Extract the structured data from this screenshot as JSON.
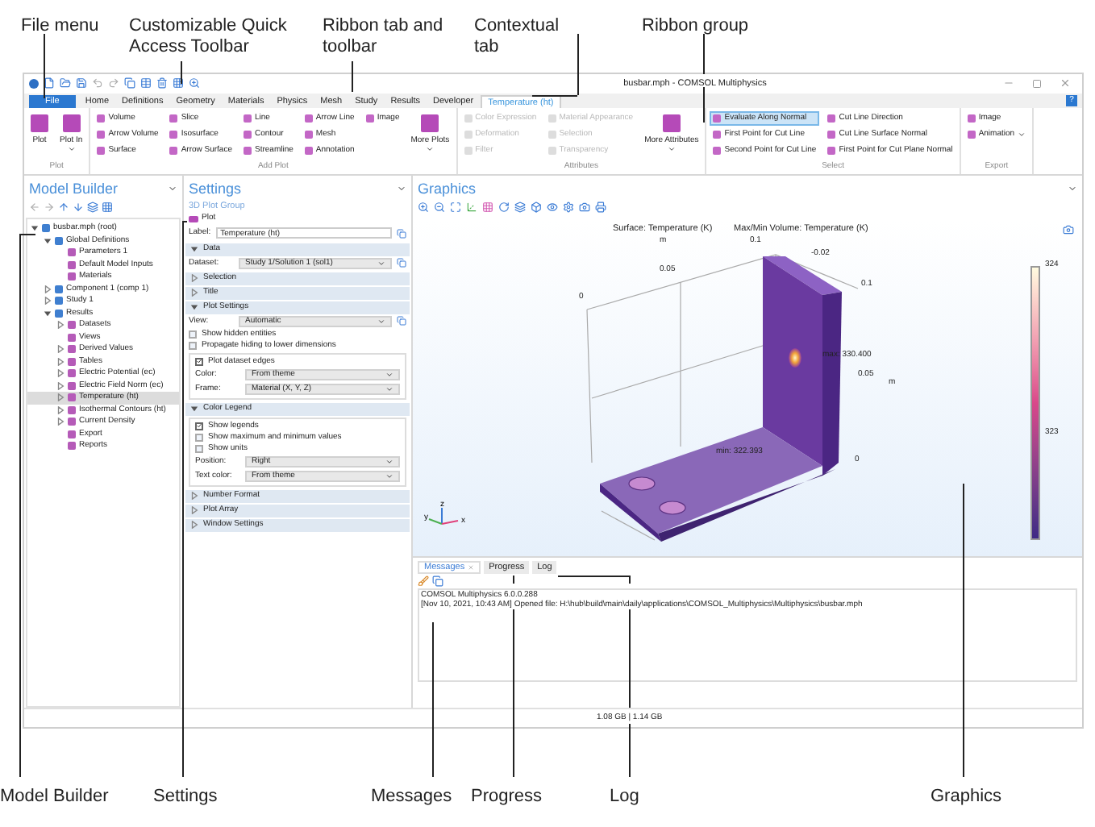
{
  "callouts_top": [
    {
      "label": "File menu"
    },
    {
      "label": "Customizable Quick Access Toolbar"
    },
    {
      "label": "Ribbon tab and toolbar"
    },
    {
      "label": "Contextual tab"
    },
    {
      "label": "Ribbon group"
    }
  ],
  "window": {
    "title": "busbar.mph - COMSOL Multiphysics"
  },
  "help_button": "?",
  "ribbon_tabs": [
    {
      "label": "File",
      "kind": "file",
      "selected": false
    },
    {
      "label": "Home",
      "kind": "standard",
      "selected": false
    },
    {
      "label": "Definitions",
      "kind": "standard",
      "selected": false
    },
    {
      "label": "Geometry",
      "kind": "standard",
      "selected": false
    },
    {
      "label": "Materials",
      "kind": "standard",
      "selected": false
    },
    {
      "label": "Physics",
      "kind": "standard",
      "selected": false
    },
    {
      "label": "Mesh",
      "kind": "standard",
      "selected": false
    },
    {
      "label": "Study",
      "kind": "standard",
      "selected": false
    },
    {
      "label": "Results",
      "kind": "standard",
      "selected": false
    },
    {
      "label": "Developer",
      "kind": "standard",
      "selected": false
    },
    {
      "label": "Temperature (ht)",
      "kind": "contextual",
      "selected": true
    }
  ],
  "ribbon_groups": [
    {
      "label": "Plot",
      "items": [
        {
          "kind": "big",
          "label": "Plot",
          "dropdown": false
        },
        {
          "kind": "big",
          "label": "Plot In",
          "dropdown": true
        }
      ]
    },
    {
      "label": "Add Plot",
      "items": [
        {
          "kind": "column",
          "entries": [
            {
              "label": "Volume"
            },
            {
              "label": "Arrow Volume"
            },
            {
              "label": "Surface"
            }
          ]
        },
        {
          "kind": "column",
          "entries": [
            {
              "label": "Slice"
            },
            {
              "label": "Isosurface"
            },
            {
              "label": "Arrow Surface"
            }
          ]
        },
        {
          "kind": "column",
          "entries": [
            {
              "label": "Line"
            },
            {
              "label": "Contour"
            },
            {
              "label": "Streamline"
            }
          ]
        },
        {
          "kind": "column",
          "entries": [
            {
              "label": "Arrow Line"
            },
            {
              "label": "Mesh"
            },
            {
              "label": "Annotation"
            }
          ]
        },
        {
          "kind": "column",
          "entries": [
            {
              "label": "Image"
            }
          ]
        },
        {
          "kind": "big",
          "label": "More Plots",
          "dropdown": true
        }
      ]
    },
    {
      "label": "Attributes",
      "items": [
        {
          "kind": "column",
          "entries": [
            {
              "label": "Color Expression",
              "disabled": true
            },
            {
              "label": "Deformation",
              "disabled": true
            },
            {
              "label": "Filter",
              "disabled": true
            }
          ]
        },
        {
          "kind": "column",
          "entries": [
            {
              "label": "Material Appearance",
              "disabled": true
            },
            {
              "label": "Selection",
              "disabled": true
            },
            {
              "label": "Transparency",
              "disabled": true
            }
          ]
        },
        {
          "kind": "big",
          "label": "More Attributes",
          "dropdown": true
        }
      ]
    },
    {
      "label": "Select",
      "items": [
        {
          "kind": "column",
          "entries": [
            {
              "label": "Evaluate Along Normal",
              "selected": true
            },
            {
              "label": "First Point for Cut Line",
              "selected": false
            },
            {
              "label": "Second Point for Cut Line",
              "selected": false
            }
          ]
        },
        {
          "kind": "column",
          "entries": [
            {
              "label": "Cut Line Direction",
              "selected": false
            },
            {
              "label": "Cut Line Surface Normal",
              "selected": false
            },
            {
              "label": "First Point for Cut Plane Normal",
              "selected": false
            }
          ]
        }
      ]
    },
    {
      "label": "Export",
      "items": [
        {
          "kind": "column",
          "entries": [
            {
              "label": "Image"
            },
            {
              "label": "Animation",
              "dropdown": true
            }
          ]
        }
      ]
    }
  ],
  "model_builder": {
    "title": "Model Builder",
    "tree": [
      {
        "label": "busbar.mph (root)",
        "expanded": true,
        "selected": false,
        "children": [
          {
            "label": "Global Definitions",
            "expanded": true,
            "selected": false,
            "children": [
              {
                "label": "Parameters 1",
                "selected": false
              },
              {
                "label": "Default Model Inputs",
                "selected": false
              },
              {
                "label": "Materials",
                "selected": false
              }
            ]
          },
          {
            "label": "Component 1 (comp 1)",
            "expanded": false,
            "selected": false
          },
          {
            "label": "Study 1",
            "expanded": false,
            "selected": false
          },
          {
            "label": "Results",
            "expanded": true,
            "selected": false,
            "children": [
              {
                "label": "Datasets",
                "expanded": false,
                "selected": false
              },
              {
                "label": "Views",
                "selected": false
              },
              {
                "label": "Derived Values",
                "expanded": false,
                "selected": false
              },
              {
                "label": "Tables",
                "expanded": false,
                "selected": false
              },
              {
                "label": "Electric Potential (ec)",
                "expanded": false,
                "selected": false
              },
              {
                "label": "Electric Field Norm (ec)",
                "expanded": false,
                "selected": false
              },
              {
                "label": "Temperature (ht)",
                "expanded": false,
                "selected": true
              },
              {
                "label": "Isothermal Contours (ht)",
                "expanded": false,
                "selected": false
              },
              {
                "label": "Current Density",
                "expanded": false,
                "selected": false
              },
              {
                "label": "Export",
                "selected": false
              },
              {
                "label": "Reports",
                "selected": false
              }
            ]
          }
        ]
      }
    ]
  },
  "settings": {
    "title": "Settings",
    "subtitle": "3D Plot Group",
    "plot_button": "Plot",
    "label_field": {
      "label": "Label:",
      "value": "Temperature (ht)"
    },
    "sections": [
      {
        "title": "Data",
        "expanded": true,
        "rows": [
          {
            "kind": "select",
            "label": "Dataset:",
            "value": "Study 1/Solution 1 (sol1)",
            "side_button": true
          }
        ]
      },
      {
        "title": "Selection",
        "expanded": false
      },
      {
        "title": "Title",
        "expanded": false
      },
      {
        "title": "Plot Settings",
        "expanded": true,
        "rows": [
          {
            "kind": "select",
            "label": "View:",
            "value": "Automatic",
            "side_button": true
          },
          {
            "kind": "checkbox",
            "label": "Show hidden entities",
            "checked": false
          },
          {
            "kind": "checkbox",
            "label": "Propagate hiding to lower dimensions",
            "checked": false
          },
          {
            "kind": "group",
            "rows": [
              {
                "kind": "checkbox",
                "label": "Plot dataset edges",
                "checked": true
              },
              {
                "kind": "select",
                "label": "Color:",
                "value": "From theme"
              },
              {
                "kind": "select",
                "label": "Frame:",
                "value": "Material  (X, Y, Z)"
              }
            ]
          }
        ]
      },
      {
        "title": "Color Legend",
        "expanded": true,
        "rows": [
          {
            "kind": "group",
            "rows": [
              {
                "kind": "checkbox",
                "label": "Show legends",
                "checked": true
              },
              {
                "kind": "checkbox",
                "label": "Show maximum and minimum values",
                "checked": false
              },
              {
                "kind": "checkbox",
                "label": "Show units",
                "checked": false
              },
              {
                "kind": "select",
                "label": "Position:",
                "value": "Right"
              },
              {
                "kind": "select",
                "label": "Text color:",
                "value": "From theme"
              }
            ]
          }
        ]
      },
      {
        "title": "Number Format",
        "expanded": false
      },
      {
        "title": "Plot Array",
        "expanded": false
      },
      {
        "title": "Window Settings",
        "expanded": false
      }
    ]
  },
  "graphics": {
    "title": "Graphics",
    "plot_titles": [
      "Surface: Temperature (K)",
      "Max/Min Volume: Temperature (K)"
    ],
    "axis_labels": [
      "m",
      "0.1",
      "-0.02",
      "0.05",
      "0",
      "0.1",
      "0.05",
      "m",
      "0"
    ],
    "max_label": "max: 330.400",
    "min_label": "min: 322.393",
    "colorbar_ticks": [
      "324",
      "323"
    ],
    "triad": [
      "z",
      "y",
      "x"
    ]
  },
  "messages": {
    "tabs": [
      {
        "label": "Messages",
        "selected": true,
        "closable": true
      },
      {
        "label": "Progress",
        "selected": false
      },
      {
        "label": "Log",
        "selected": false
      }
    ],
    "lines": [
      "COMSOL Multiphysics 6.0.0.288",
      "[Nov 10, 2021, 10:43 AM] Opened file: H:\\hub\\build\\main\\daily\\applications\\COMSOL_Multiphysics\\Multiphysics\\busbar.mph"
    ]
  },
  "status_bar": "1.08 GB | 1.14 GB",
  "callouts_bottom": [
    {
      "label": "Model Builder"
    },
    {
      "label": "Settings"
    },
    {
      "label": "Messages"
    },
    {
      "label": "Progress"
    },
    {
      "label": "Log"
    },
    {
      "label": "Graphics"
    }
  ]
}
